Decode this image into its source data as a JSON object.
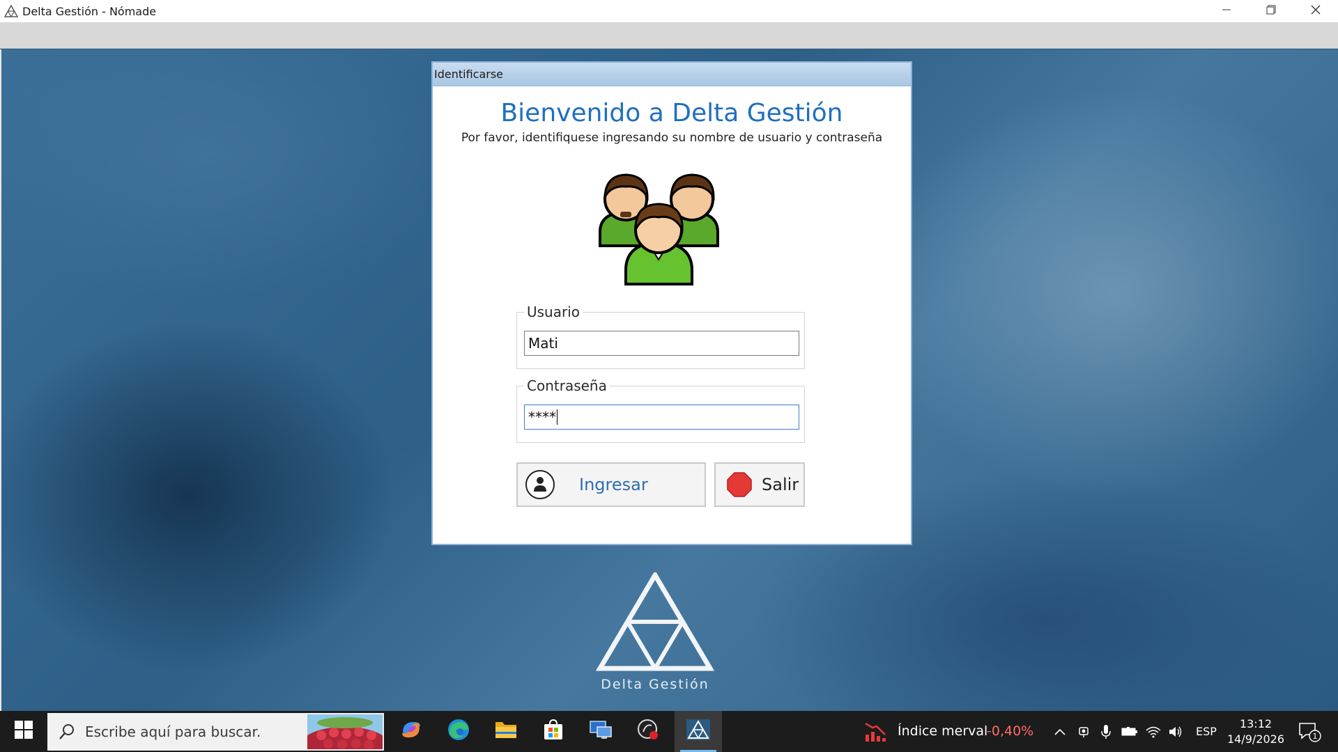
{
  "window": {
    "title": "Delta Gestión - Nómade",
    "controls": [
      "minimize-icon",
      "restore-icon",
      "close-icon"
    ]
  },
  "dialog": {
    "title": "Identificarse",
    "welcome": "Bienvenido a Delta Gestión",
    "instructions": "Por favor, identifiquese ingresando su nombre de usuario y contraseña",
    "user_group_label": "Usuario",
    "user_value": "Mati",
    "password_group_label": "Contraseña",
    "password_value": "****",
    "login_label": "Ingresar",
    "exit_label": "Salir"
  },
  "logo": {
    "text": "Delta Gestión"
  },
  "taskbar": {
    "search_placeholder": "Escribe aquí para buscar.",
    "apps": [
      "copilot-icon",
      "edge-icon",
      "file-explorer-icon",
      "store-icon",
      "remote-desktop-icon",
      "recorder-icon",
      "delta-gestion-icon"
    ],
    "active_app": "delta-gestion-icon",
    "widget_label": "Índice merval",
    "widget_value": "-0,40%",
    "language": "ESP",
    "time": "13:12",
    "date": "14/9/2026",
    "notifications_count": "1"
  },
  "colors": {
    "accent": "#1f6fbf",
    "taskbar": "#1c1c1c",
    "negative": "#ff6a6a",
    "exit_red": "#e53935"
  }
}
